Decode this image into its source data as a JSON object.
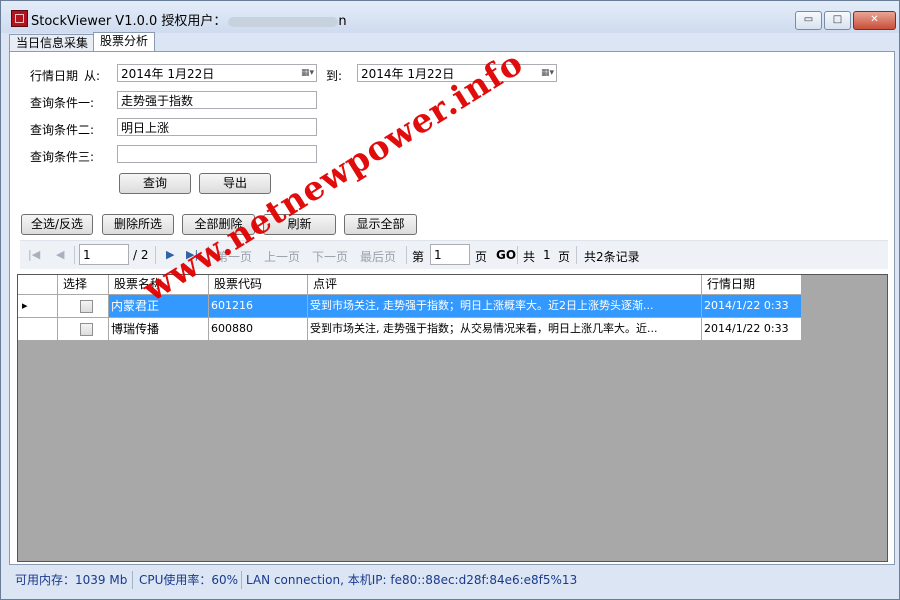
{
  "window": {
    "title_prefix": "StockViewer V1.0.0 授权用户：",
    "title_suffix_visible": "n",
    "controls": {
      "minimize": "▭",
      "maximize": "□",
      "close": "✕"
    }
  },
  "tabs": [
    {
      "label": "当日信息采集",
      "active": false
    },
    {
      "label": "股票分析",
      "active": true
    }
  ],
  "filters": {
    "date_label": "行情日期",
    "from_label": "从:",
    "from_value": "2014年  1月22日",
    "to_label": "到:",
    "to_value": "2014年  1月22日",
    "date_dropdown_glyph": "▦▾",
    "cond1_label": "查询条件一:",
    "cond1_value": "走势强于指数",
    "cond2_label": "查询条件二:",
    "cond2_value": "明日上涨",
    "cond3_label": "查询条件三:",
    "cond3_value": ""
  },
  "actions": {
    "query": "查询",
    "export": "导出"
  },
  "toolbar": {
    "select_toggle": "全选/反选",
    "delete_selected": "删除所选",
    "delete_all": "全部删除",
    "refresh": "刷新",
    "show_all": "显示全部"
  },
  "pager": {
    "first_icon": "|◀",
    "prev_icon": "◀",
    "next_icon": "▶",
    "last_icon": "▶|",
    "page_value": "1",
    "page_total": "/ 2",
    "first_page": "第一页",
    "prev_page": "上一页",
    "next_page": "下一页",
    "last_page": "最后页",
    "goto_prefix": "第",
    "goto_value": "1",
    "goto_suffix": "页",
    "go": "GO",
    "total_prefix": "共",
    "total_pages": "1",
    "total_suffix": "页",
    "records": "共2条记录"
  },
  "table": {
    "columns": [
      "选择",
      "股票名称",
      "股票代码",
      "点评",
      "行情日期"
    ],
    "rows": [
      {
        "indicator": "▸",
        "name": "内蒙君正",
        "code": "601216",
        "comment": "受到市场关注, 走势强于指数；明日上涨概率大。近2日上涨势头逐渐...",
        "date": "2014/1/22 0:33",
        "selected": true
      },
      {
        "indicator": "",
        "name": "博瑞传播",
        "code": "600880",
        "comment": "受到市场关注, 走势强于指数；从交易情况来看，明日上涨几率大。近...",
        "date": "2014/1/22 0:33",
        "selected": false
      }
    ]
  },
  "status": {
    "memory": "可用内存：1039 Mb",
    "cpu": "CPU使用率：60%",
    "network": "LAN connection, 本机IP: fe80::88ec:d28f:84e6:e8f5%13"
  },
  "watermark": "www.netnewpower.info",
  "colors": {
    "selection": "#3399ff",
    "watermark": "#e00000",
    "status_text": "#1a3a8c"
  }
}
